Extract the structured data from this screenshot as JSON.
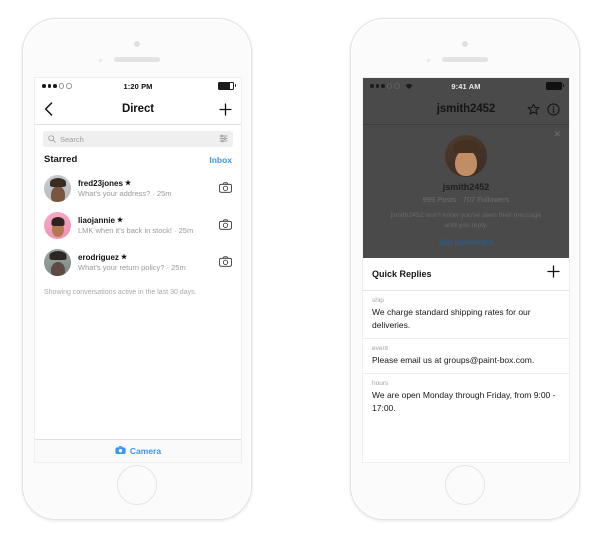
{
  "colors": {
    "accent_blue": "#3897f0",
    "link_dim_blue": "#2c5b84",
    "overlay_grey": "#4a4a4a",
    "text_primary": "#111111",
    "text_secondary": "#9a9a9a",
    "divider": "#e0e0e0"
  },
  "left_phone": {
    "status_bar": {
      "carrier_signal": "3 of 5 bars",
      "time": "1:20 PM",
      "battery": "full"
    },
    "nav": {
      "back_icon": "chevron-left-icon",
      "title": "Direct",
      "add_icon": "plus-icon"
    },
    "search": {
      "icon": "search-icon",
      "placeholder": "Search",
      "value": "",
      "filter_icon": "sliders-icon"
    },
    "section": {
      "title": "Starred",
      "link": "Inbox"
    },
    "conversations": [
      {
        "username": "fred23jones",
        "starred": "★",
        "preview": "What's your address? · 25m",
        "camera_icon": "camera-icon",
        "avatar": "avatar-fred23jones"
      },
      {
        "username": "liaojannie",
        "starred": "★",
        "preview": "LMK when it's back in stock! · 25m",
        "camera_icon": "camera-icon",
        "avatar": "avatar-liaojannie"
      },
      {
        "username": "erodriguez",
        "starred": "★",
        "preview": "What's your return policy? · 25m",
        "camera_icon": "camera-icon",
        "avatar": "avatar-erodriguez"
      }
    ],
    "list_note": "Showing conversations active in the last 30 days.",
    "camera_bar": {
      "icon": "camera-icon",
      "label": "Camera"
    }
  },
  "right_phone": {
    "status_bar": {
      "carrier_signal": "3 of 5 bars",
      "wifi_icon": "wifi-icon",
      "time": "9:41 AM",
      "battery": "full"
    },
    "nav": {
      "title": "jsmith2452",
      "star_icon": "star-outline-icon",
      "info_icon": "info-circle-icon"
    },
    "profile_overlay": {
      "close_icon": "close-icon",
      "avatar": "avatar-jsmith2452",
      "name": "jsmith2452",
      "stats": "999 Posts · 707 Followers",
      "notice": "jsmith2452 won't know you've seen their message until you reply.",
      "action_label": "Not interested"
    },
    "quick_replies": {
      "title": "Quick Replies",
      "add_icon": "plus-icon",
      "items": [
        {
          "shortcut": "ship",
          "message": "We charge standard shipping rates for our deliveries."
        },
        {
          "shortcut": "event",
          "message": "Please email us at groups@paint-box.com."
        },
        {
          "shortcut": "hours",
          "message": "We are open Monday through Friday, from 9:00 - 17:00."
        }
      ]
    }
  }
}
